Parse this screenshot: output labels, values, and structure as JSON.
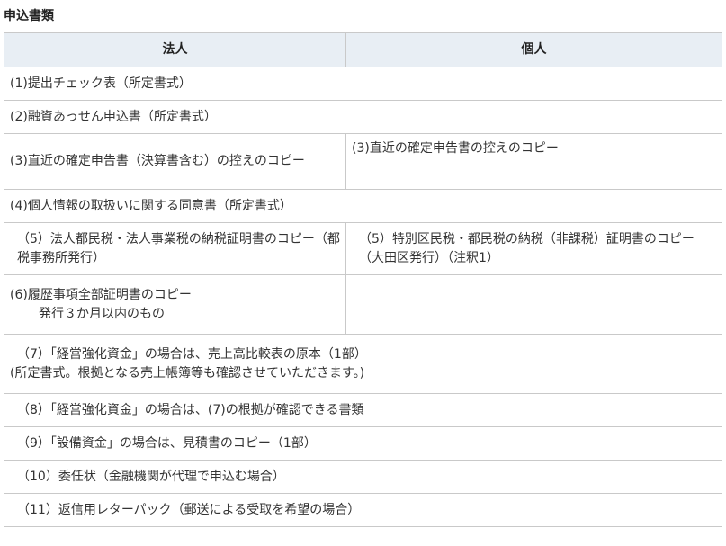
{
  "heading": "申込書類",
  "columns": [
    "法人",
    "個人"
  ],
  "rows": {
    "r1": "(1)提出チェック表（所定書式）",
    "r2": "(2)融資あっせん申込書（所定書式）",
    "r3": {
      "corporate": "(3)直近の確定申告書（決算書含む）の控えのコピー",
      "individual": "(3)直近の確定申告書の控えのコピー"
    },
    "r4": "(4)個人情報の取扱いに関する同意書（所定書式）",
    "r5": {
      "corporate": "（5）法人都民税・法人事業税の納税証明書のコピー（都税事務所発行）",
      "individual": "（5）特別区民税・都民税の納税（非課税）証明書のコピー（大田区発行）（注釈1）"
    },
    "r6": {
      "line1": "(6)履歴事項全部証明書のコピー",
      "line2": "発行３か月以内のもの",
      "individual": ""
    },
    "r7": {
      "line1": "（7）「経営強化資金」の場合は、売上高比較表の原本（1部）",
      "line2": "(所定書式。根拠となる売上帳簿等も確認させていただきます。)"
    },
    "r8": "（8）「経営強化資金」の場合は、(7)の根拠が確認できる書類",
    "r9": "（9）「設備資金」の場合は、見積書のコピー（1部）",
    "r10": "（10）委任状（金融機関が代理で申込む場合）",
    "r11": "（11）返信用レターパック（郵送による受取を希望の場合）"
  }
}
